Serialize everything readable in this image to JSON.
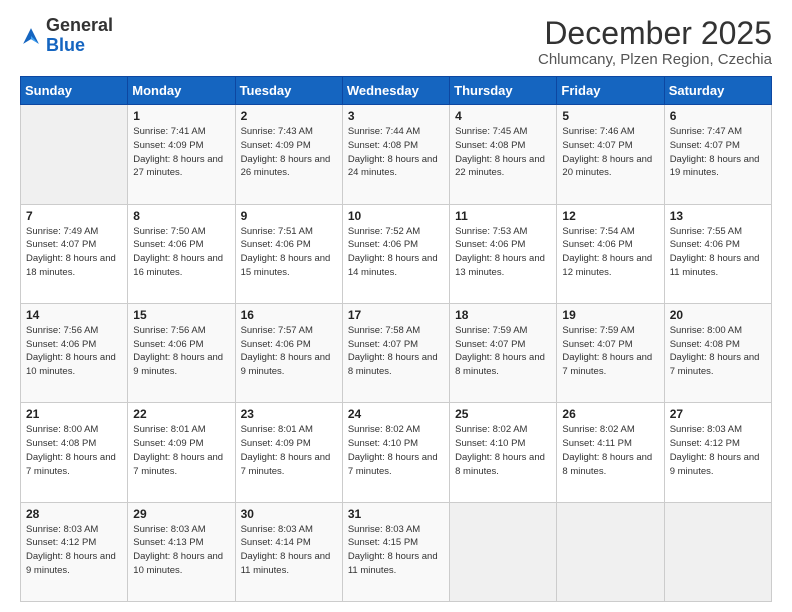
{
  "logo": {
    "line1": "General",
    "line2": "Blue"
  },
  "title": "December 2025",
  "subtitle": "Chlumcany, Plzen Region, Czechia",
  "days_header": [
    "Sunday",
    "Monday",
    "Tuesday",
    "Wednesday",
    "Thursday",
    "Friday",
    "Saturday"
  ],
  "weeks": [
    [
      {
        "day": "",
        "sunrise": "",
        "sunset": "",
        "daylight": ""
      },
      {
        "day": "1",
        "sunrise": "Sunrise: 7:41 AM",
        "sunset": "Sunset: 4:09 PM",
        "daylight": "Daylight: 8 hours and 27 minutes."
      },
      {
        "day": "2",
        "sunrise": "Sunrise: 7:43 AM",
        "sunset": "Sunset: 4:09 PM",
        "daylight": "Daylight: 8 hours and 26 minutes."
      },
      {
        "day": "3",
        "sunrise": "Sunrise: 7:44 AM",
        "sunset": "Sunset: 4:08 PM",
        "daylight": "Daylight: 8 hours and 24 minutes."
      },
      {
        "day": "4",
        "sunrise": "Sunrise: 7:45 AM",
        "sunset": "Sunset: 4:08 PM",
        "daylight": "Daylight: 8 hours and 22 minutes."
      },
      {
        "day": "5",
        "sunrise": "Sunrise: 7:46 AM",
        "sunset": "Sunset: 4:07 PM",
        "daylight": "Daylight: 8 hours and 20 minutes."
      },
      {
        "day": "6",
        "sunrise": "Sunrise: 7:47 AM",
        "sunset": "Sunset: 4:07 PM",
        "daylight": "Daylight: 8 hours and 19 minutes."
      }
    ],
    [
      {
        "day": "7",
        "sunrise": "Sunrise: 7:49 AM",
        "sunset": "Sunset: 4:07 PM",
        "daylight": "Daylight: 8 hours and 18 minutes."
      },
      {
        "day": "8",
        "sunrise": "Sunrise: 7:50 AM",
        "sunset": "Sunset: 4:06 PM",
        "daylight": "Daylight: 8 hours and 16 minutes."
      },
      {
        "day": "9",
        "sunrise": "Sunrise: 7:51 AM",
        "sunset": "Sunset: 4:06 PM",
        "daylight": "Daylight: 8 hours and 15 minutes."
      },
      {
        "day": "10",
        "sunrise": "Sunrise: 7:52 AM",
        "sunset": "Sunset: 4:06 PM",
        "daylight": "Daylight: 8 hours and 14 minutes."
      },
      {
        "day": "11",
        "sunrise": "Sunrise: 7:53 AM",
        "sunset": "Sunset: 4:06 PM",
        "daylight": "Daylight: 8 hours and 13 minutes."
      },
      {
        "day": "12",
        "sunrise": "Sunrise: 7:54 AM",
        "sunset": "Sunset: 4:06 PM",
        "daylight": "Daylight: 8 hours and 12 minutes."
      },
      {
        "day": "13",
        "sunrise": "Sunrise: 7:55 AM",
        "sunset": "Sunset: 4:06 PM",
        "daylight": "Daylight: 8 hours and 11 minutes."
      }
    ],
    [
      {
        "day": "14",
        "sunrise": "Sunrise: 7:56 AM",
        "sunset": "Sunset: 4:06 PM",
        "daylight": "Daylight: 8 hours and 10 minutes."
      },
      {
        "day": "15",
        "sunrise": "Sunrise: 7:56 AM",
        "sunset": "Sunset: 4:06 PM",
        "daylight": "Daylight: 8 hours and 9 minutes."
      },
      {
        "day": "16",
        "sunrise": "Sunrise: 7:57 AM",
        "sunset": "Sunset: 4:06 PM",
        "daylight": "Daylight: 8 hours and 9 minutes."
      },
      {
        "day": "17",
        "sunrise": "Sunrise: 7:58 AM",
        "sunset": "Sunset: 4:07 PM",
        "daylight": "Daylight: 8 hours and 8 minutes."
      },
      {
        "day": "18",
        "sunrise": "Sunrise: 7:59 AM",
        "sunset": "Sunset: 4:07 PM",
        "daylight": "Daylight: 8 hours and 8 minutes."
      },
      {
        "day": "19",
        "sunrise": "Sunrise: 7:59 AM",
        "sunset": "Sunset: 4:07 PM",
        "daylight": "Daylight: 8 hours and 7 minutes."
      },
      {
        "day": "20",
        "sunrise": "Sunrise: 8:00 AM",
        "sunset": "Sunset: 4:08 PM",
        "daylight": "Daylight: 8 hours and 7 minutes."
      }
    ],
    [
      {
        "day": "21",
        "sunrise": "Sunrise: 8:00 AM",
        "sunset": "Sunset: 4:08 PM",
        "daylight": "Daylight: 8 hours and 7 minutes."
      },
      {
        "day": "22",
        "sunrise": "Sunrise: 8:01 AM",
        "sunset": "Sunset: 4:09 PM",
        "daylight": "Daylight: 8 hours and 7 minutes."
      },
      {
        "day": "23",
        "sunrise": "Sunrise: 8:01 AM",
        "sunset": "Sunset: 4:09 PM",
        "daylight": "Daylight: 8 hours and 7 minutes."
      },
      {
        "day": "24",
        "sunrise": "Sunrise: 8:02 AM",
        "sunset": "Sunset: 4:10 PM",
        "daylight": "Daylight: 8 hours and 7 minutes."
      },
      {
        "day": "25",
        "sunrise": "Sunrise: 8:02 AM",
        "sunset": "Sunset: 4:10 PM",
        "daylight": "Daylight: 8 hours and 8 minutes."
      },
      {
        "day": "26",
        "sunrise": "Sunrise: 8:02 AM",
        "sunset": "Sunset: 4:11 PM",
        "daylight": "Daylight: 8 hours and 8 minutes."
      },
      {
        "day": "27",
        "sunrise": "Sunrise: 8:03 AM",
        "sunset": "Sunset: 4:12 PM",
        "daylight": "Daylight: 8 hours and 9 minutes."
      }
    ],
    [
      {
        "day": "28",
        "sunrise": "Sunrise: 8:03 AM",
        "sunset": "Sunset: 4:12 PM",
        "daylight": "Daylight: 8 hours and 9 minutes."
      },
      {
        "day": "29",
        "sunrise": "Sunrise: 8:03 AM",
        "sunset": "Sunset: 4:13 PM",
        "daylight": "Daylight: 8 hours and 10 minutes."
      },
      {
        "day": "30",
        "sunrise": "Sunrise: 8:03 AM",
        "sunset": "Sunset: 4:14 PM",
        "daylight": "Daylight: 8 hours and 11 minutes."
      },
      {
        "day": "31",
        "sunrise": "Sunrise: 8:03 AM",
        "sunset": "Sunset: 4:15 PM",
        "daylight": "Daylight: 8 hours and 11 minutes."
      },
      {
        "day": "",
        "sunrise": "",
        "sunset": "",
        "daylight": ""
      },
      {
        "day": "",
        "sunrise": "",
        "sunset": "",
        "daylight": ""
      },
      {
        "day": "",
        "sunrise": "",
        "sunset": "",
        "daylight": ""
      }
    ]
  ]
}
